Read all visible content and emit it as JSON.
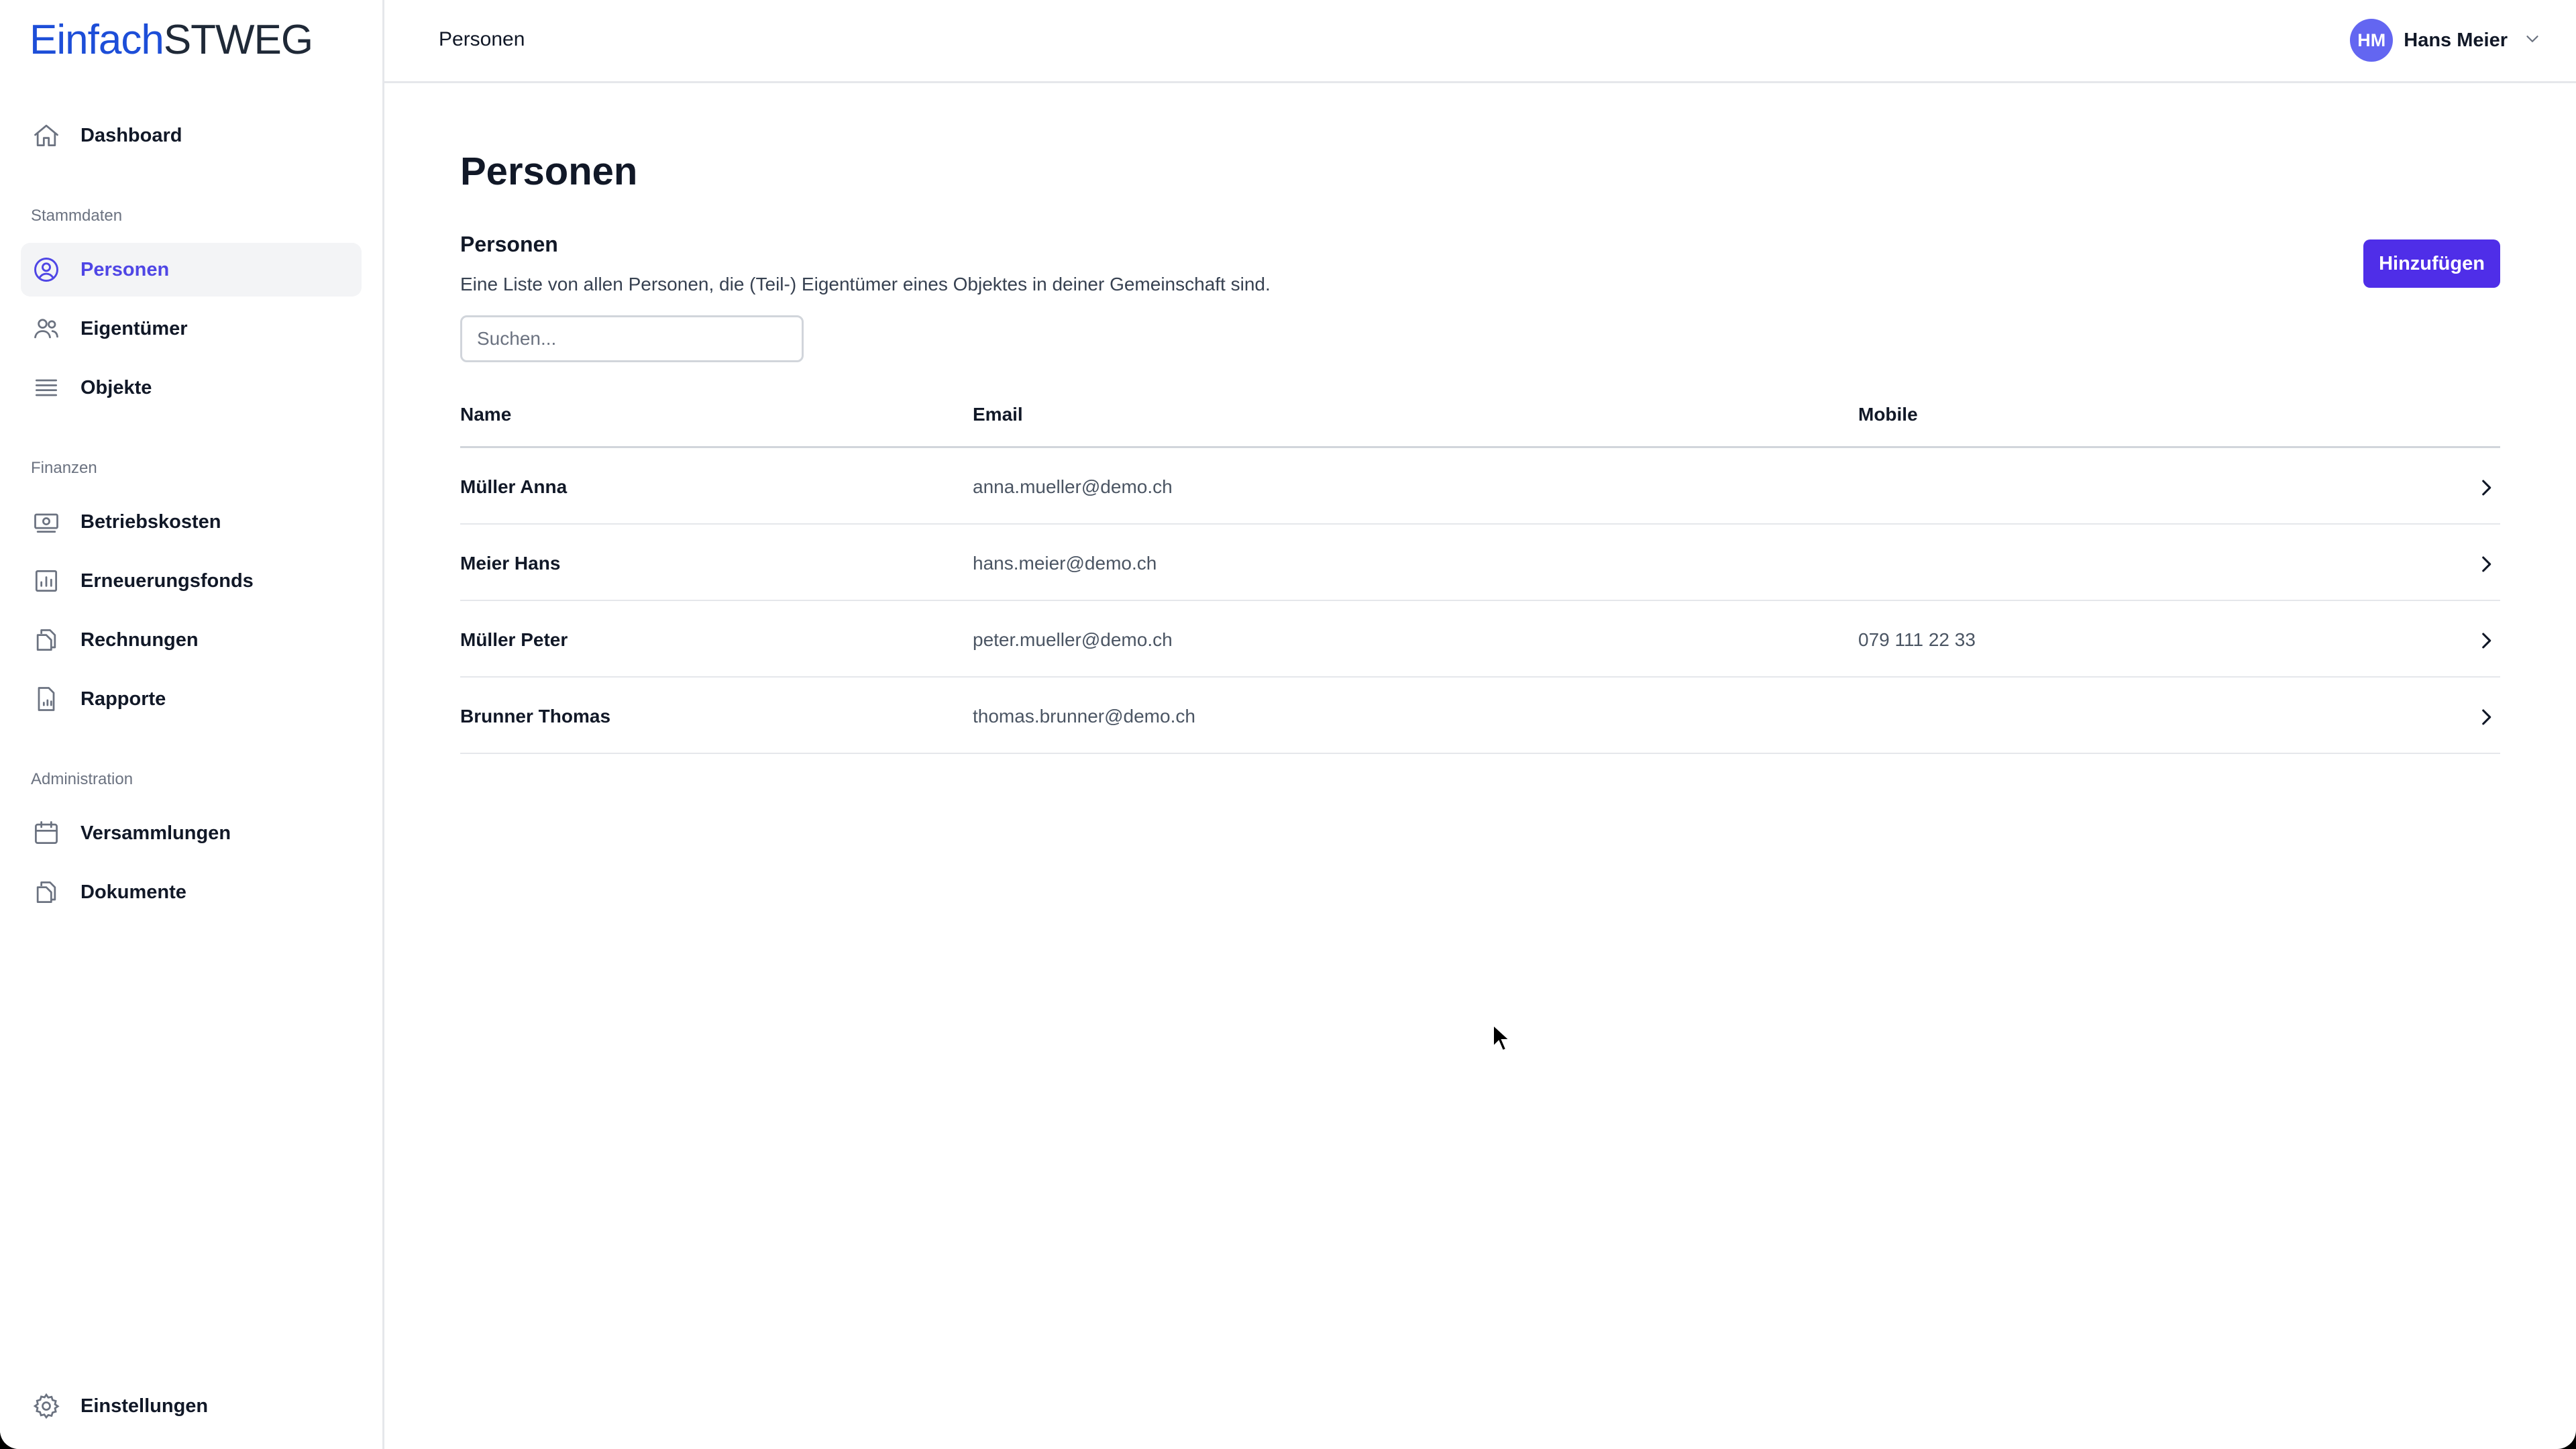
{
  "app": {
    "logo_part1": "Einfach",
    "logo_part2": "STWEG"
  },
  "sidebar": {
    "dashboard": "Dashboard",
    "sections": {
      "stammdaten": "Stammdaten",
      "finanzen": "Finanzen",
      "administration": "Administration"
    },
    "items": {
      "personen": "Personen",
      "eigentuemer": "Eigentümer",
      "objekte": "Objekte",
      "betriebskosten": "Betriebskosten",
      "erneuerungsfonds": "Erneuerungsfonds",
      "rechnungen": "Rechnungen",
      "rapporte": "Rapporte",
      "versammlungen": "Versammlungen",
      "dokumente": "Dokumente"
    },
    "settings": "Einstellungen",
    "active": "personen"
  },
  "header": {
    "breadcrumb": "Personen",
    "user": {
      "initials": "HM",
      "name": "Hans Meier"
    }
  },
  "main": {
    "title": "Personen",
    "section_title": "Personen",
    "section_description": "Eine Liste von allen Personen, die (Teil-) Eigentümer eines Objektes in deiner Gemeinschaft sind.",
    "add_button": "Hinzufügen",
    "search_placeholder": "Suchen...",
    "search_value": "",
    "table": {
      "columns": [
        "Name",
        "Email",
        "Mobile"
      ],
      "rows": [
        {
          "name": "Müller Anna",
          "email": "anna.mueller@demo.ch",
          "mobile": ""
        },
        {
          "name": "Meier Hans",
          "email": "hans.meier@demo.ch",
          "mobile": ""
        },
        {
          "name": "Müller Peter",
          "email": "peter.mueller@demo.ch",
          "mobile": "079 111 22 33"
        },
        {
          "name": "Brunner Thomas",
          "email": "thomas.brunner@demo.ch",
          "mobile": ""
        }
      ]
    }
  },
  "colors": {
    "accent": "#4f46e5",
    "button": "#4f2ee8",
    "avatar": "#6366f1",
    "logo_blue": "#1d4ed8"
  },
  "icons": {
    "dashboard": "home-icon",
    "personen": "user-circle-icon",
    "eigentuemer": "users-icon",
    "objekte": "list-icon",
    "betriebskosten": "banknote-icon",
    "erneuerungsfonds": "bar-chart-icon",
    "rechnungen": "documents-icon",
    "rapporte": "report-icon",
    "versammlungen": "calendar-icon",
    "dokumente": "documents-icon",
    "settings": "gear-icon"
  }
}
